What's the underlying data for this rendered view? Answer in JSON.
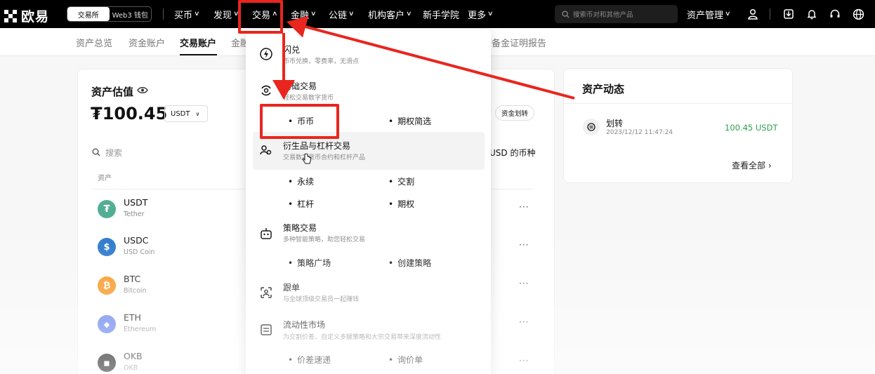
{
  "brand": {
    "name": "欧易"
  },
  "mode_switch": {
    "exchange": "交易所",
    "wallet": "Web3 钱包"
  },
  "nav": {
    "items": [
      {
        "label": "买币",
        "chevron": true
      },
      {
        "label": "发现",
        "chevron": true
      },
      {
        "label": "交易",
        "chevron": true
      },
      {
        "label": "金融",
        "chevron": true
      },
      {
        "label": "公链",
        "chevron": true
      },
      {
        "label": "机构客户",
        "chevron": true
      },
      {
        "label": "新手学院",
        "chevron": false
      },
      {
        "label": "更多",
        "chevron": true
      }
    ],
    "search_placeholder": "搜索币对和其他产品",
    "asset_mgmt": "资产管理"
  },
  "subnav": {
    "items": [
      "资产总览",
      "资金账户",
      "交易账户",
      "金融",
      "备金证明报告"
    ],
    "active": "交易账户"
  },
  "asset_card": {
    "title": "资产估值",
    "value": "₮100.45",
    "currency": "USDT",
    "transfer_btn": "资金划转",
    "search_placeholder": "搜索",
    "hide_small_label": "USD 的币种",
    "col_header": "资产",
    "coins": [
      {
        "symbol": "USDT",
        "name": "Tether",
        "color": "#53ae94",
        "glyph": "₮"
      },
      {
        "symbol": "USDC",
        "name": "USD Coin",
        "color": "#2775ca",
        "glyph": "$"
      },
      {
        "symbol": "BTC",
        "name": "Bitcoin",
        "color": "#f7931a",
        "glyph": "₿"
      },
      {
        "symbol": "ETH",
        "name": "Ethereum",
        "color": "#627eea",
        "glyph": "◆"
      },
      {
        "symbol": "OKB",
        "name": "OKB",
        "color": "#000000",
        "glyph": "◼"
      }
    ],
    "more": "···"
  },
  "activity": {
    "title": "资产动态",
    "item_type": "划转",
    "item_time": "2023/12/12 11:47:24",
    "item_amount": "100.45 USDT",
    "amount_color": "#2f9e4f",
    "view_all": "查看全部"
  },
  "dropdown": {
    "flash": {
      "title": "闪兑",
      "desc": "币币兑换，零费率，无滑点"
    },
    "basic": {
      "title": "基础交易",
      "desc": "轻松交易数字货币"
    },
    "basic_items": [
      "币币",
      "期权简选"
    ],
    "deriv": {
      "title": "衍生品与杠杆交易",
      "desc": "交易数字货币合约和杠杆产品"
    },
    "deriv_items": [
      "永续",
      "交割",
      "杠杆",
      "期权"
    ],
    "strategy": {
      "title": "策略交易",
      "desc": "多种智能策略，助您轻松交易"
    },
    "strategy_items": [
      "策略广场",
      "创建策略"
    ],
    "copy": {
      "title": "跟单",
      "desc": "与全球顶级交易员一起赚钱"
    },
    "liquidity": {
      "title": "流动性市场",
      "desc": "为交割价差、自定义多腿策略和大宗交易带来深度流动性"
    },
    "liquidity_items": [
      "价差速递",
      "询价单"
    ]
  },
  "accent_red": "#e8261f"
}
